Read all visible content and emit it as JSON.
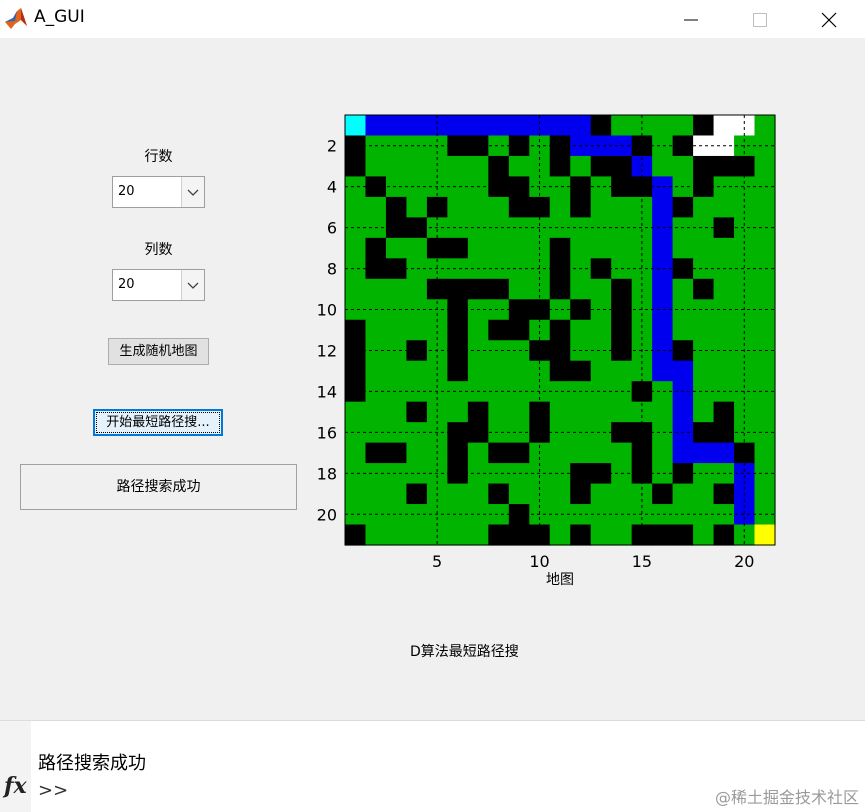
{
  "window": {
    "title": "A_GUI"
  },
  "left_panel": {
    "rows_label": "行数",
    "rows_value": "20",
    "cols_label": "列数",
    "cols_value": "20",
    "gen_button": "生成随机地图",
    "search_button": "开始最短路径搜...",
    "status_text": "路径搜索成功"
  },
  "plot": {
    "xlabel": "地图",
    "xticks": [
      "5",
      "10",
      "15",
      "20"
    ],
    "yticks": [
      "2",
      "4",
      "6",
      "8",
      "10",
      "12",
      "14",
      "16",
      "18",
      "20"
    ],
    "caption": "D算法最短路径搜"
  },
  "chart_data": {
    "type": "heatmap",
    "rows": 21,
    "cols": 21,
    "xlabel": "地图",
    "grid": true,
    "legend": "none",
    "colors": {
      "free": "#00b400",
      "obstacle": "#000000",
      "path": "#0000ee",
      "start": "#00ffff",
      "goal": "#ffff00",
      "unknown": "#ffffff"
    },
    "map": [
      "SPPPPPPPPPPPOFFFFOWW",
      "OFFFFOOFOFOPPPOFOWW",
      "OFFFFFFOFFOFOOPFFOOO",
      "FOFFFFFOOFFOFOOPFOFF",
      "FFOFOFFFOOFOFFFPOFFF",
      "FFOOFFFFFFFFFFFPFFOF",
      "FOFFOOFFFFOFFFFPFFFF",
      "FOOFFFFFFFOFOFFPOFFF",
      "FFFFOOOOFFOFFOFPFOFF",
      "FFFFFOFFOOFOFOFPFFFF",
      "OFFFFOFOOFOFFOFPFFFF",
      "OFFOFOFFFOOFFOFPOFFF",
      "OFFFFOFFFFOOFFFPPFFF",
      "OFFFFFFFFFFFFFOFPFFF",
      "FFFOFFOFFOFFFFFFPFOF",
      "FFFFFOOFFOFFFOOFPOOF",
      "FOOFFOFOOFFFFFOFPPPO",
      "FFFFFOFFFFFOOFOFOFFP",
      "FFFOFFFOFFFOFFFOFFOP",
      "FFFFFFFFOFFFFFFFFFFP",
      "OFFFFFFOOOFOFFOOOFOFG"
    ]
  }
}
